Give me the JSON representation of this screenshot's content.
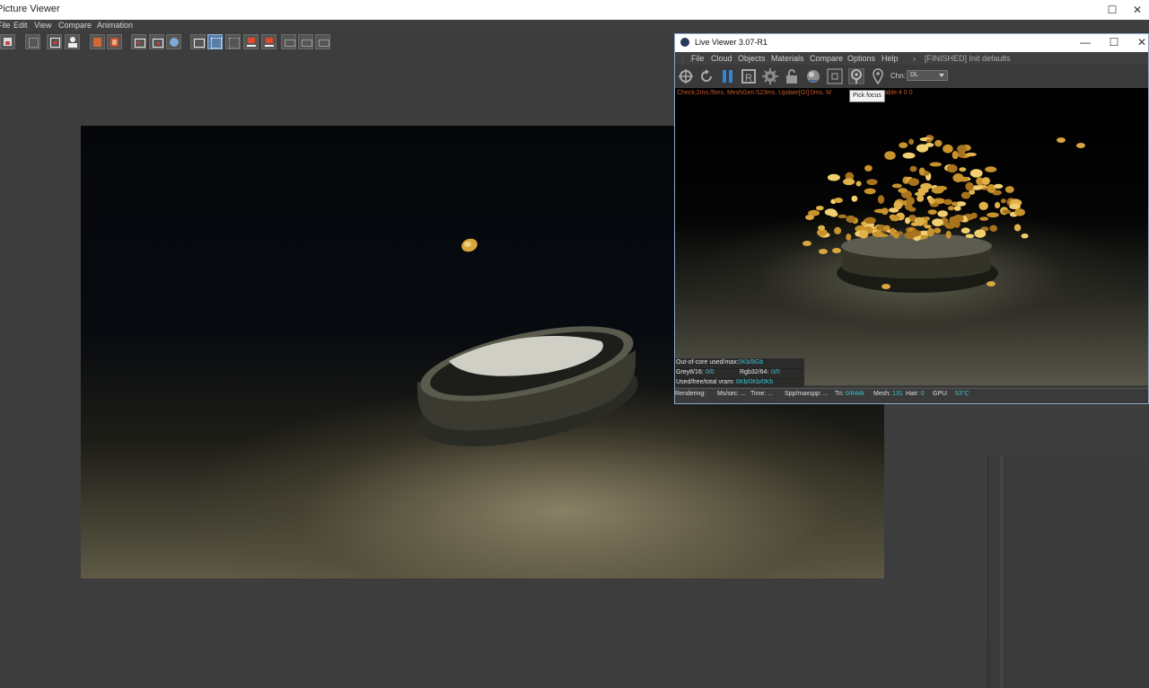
{
  "picture_viewer": {
    "title": "Picture Viewer",
    "menu": [
      "File",
      "Edit",
      "View",
      "Compare",
      "Animation"
    ]
  },
  "live_viewer": {
    "title": "Live Viewer 3.07-R1",
    "menu": [
      "File",
      "Cloud",
      "Objects",
      "Materials",
      "Compare",
      "Options",
      "Help"
    ],
    "status_message": "[FINISHED] Init defaults",
    "channel_label": "Chn:",
    "channel_value": "DL",
    "tooltip": "Pick focus",
    "stats_line": "Check:2ms./6ms. MeshGen:523ms. Update[GI]:0ms. M",
    "stats_line_tail": "184 Movable:4  0 0",
    "info_overlay": {
      "out_of_core_label": "Out-of-core used/max:",
      "out_of_core_value": "0Kb/8Gb",
      "grey_label": "Grey8/16:",
      "grey_value": "0/0",
      "rgb_label": "Rgb32/64:",
      "rgb_value": "0/0",
      "vram_label": "Used/free/total vram:",
      "vram_value": "0Kb/0Kb/0Kb"
    },
    "statusbar": {
      "rendering_label": "Rendering:",
      "ms_sec": "Ms/sec: ...",
      "time": "Time: ...",
      "spp": "Spp/maxspp: ...",
      "tri_label": "Tri:",
      "tri_value": "0/644k",
      "mesh_label": "Mesh:",
      "mesh_value": "131",
      "hair_label": "Hair:",
      "hair_value": "0",
      "gpu_label": "GPU:",
      "gpu_value": "53°C"
    }
  }
}
